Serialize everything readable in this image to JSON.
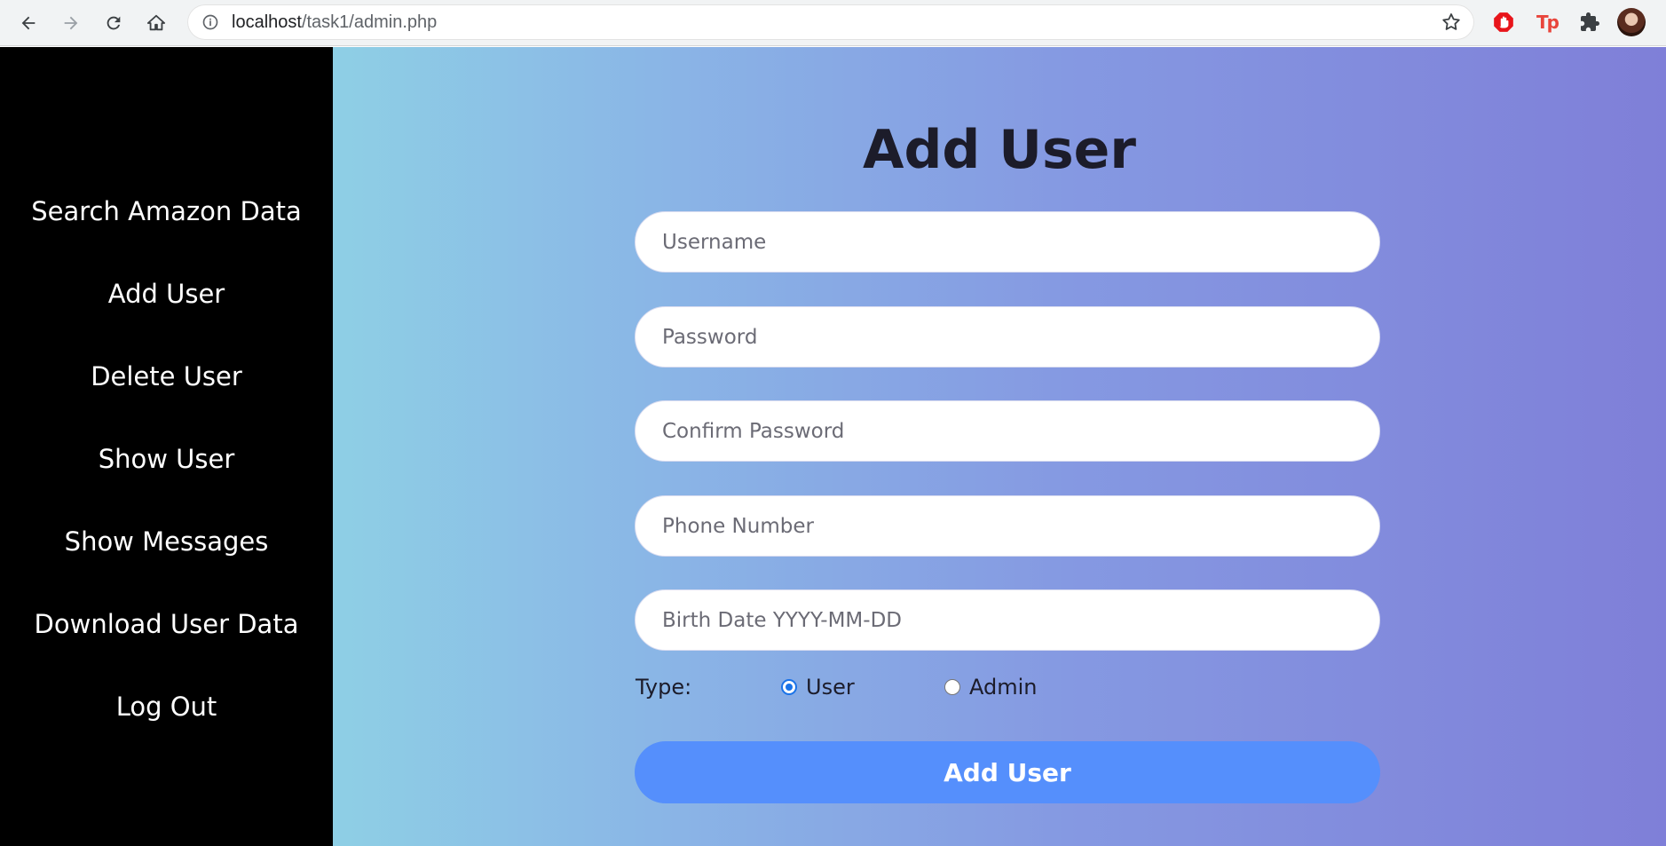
{
  "browser": {
    "url_host": "localhost",
    "url_path": "/task1/admin.php",
    "icons": [
      "back-icon",
      "forward-icon",
      "reload-icon",
      "home-icon",
      "info-icon",
      "star-icon",
      "adblock-icon",
      "tp-extension-icon",
      "extensions-puzzle-icon",
      "profile-avatar"
    ],
    "tp_label": "Tp"
  },
  "sidebar": {
    "items": [
      {
        "label": "Search Amazon Data"
      },
      {
        "label": "Add User"
      },
      {
        "label": "Delete User"
      },
      {
        "label": "Show User"
      },
      {
        "label": "Show Messages"
      },
      {
        "label": "Download User Data"
      },
      {
        "label": "Log Out"
      }
    ]
  },
  "form": {
    "title": "Add User",
    "fields": [
      {
        "placeholder": "Username",
        "value": ""
      },
      {
        "placeholder": "Password",
        "value": ""
      },
      {
        "placeholder": "Confirm Password",
        "value": ""
      },
      {
        "placeholder": "Phone Number",
        "value": ""
      },
      {
        "placeholder": "Birth Date YYYY-MM-DD",
        "value": ""
      }
    ],
    "type_label": "Type:",
    "type_options": [
      {
        "label": "User",
        "checked": true
      },
      {
        "label": "Admin",
        "checked": false
      }
    ],
    "submit_label": "Add User"
  },
  "colors": {
    "sidebar_bg": "#000000",
    "gradient_start": "#8ecfe5",
    "gradient_end": "#7f7fd8",
    "button_bg": "#558ffc"
  }
}
